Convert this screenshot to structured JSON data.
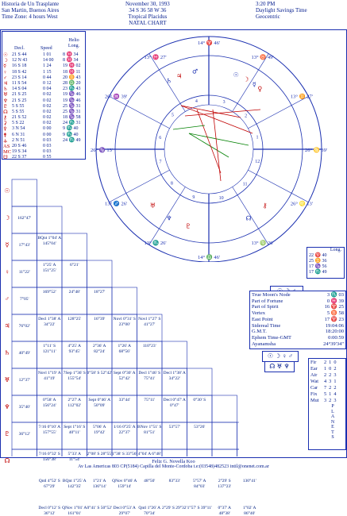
{
  "header": {
    "left": [
      "Historia de Un Trasplante",
      "San Martin, Buenos Aires",
      "Time Zone: 4 hours West"
    ],
    "center": [
      "November 30, 1993",
      "34 S 36    58 W 36",
      "Tropical Placidus",
      "NATAL CHART"
    ],
    "right": [
      "3:20 PM",
      "Daylight Savings Time",
      "Geocentric"
    ]
  },
  "planet_table": {
    "headers": {
      "decl": "Decl.",
      "speed": "Speed",
      "helio": "Helio Long."
    },
    "rows": [
      {
        "decl": "21 S 44",
        "speed": "1 01",
        "helio": "8 ♓ 34"
      },
      {
        "decl": "12 N 43",
        "speed": "14 00",
        "helio": "8 ♓ 34"
      },
      {
        "decl": "16 S 18",
        "speed": "1 24",
        "helio": "19 ♓ 02"
      },
      {
        "decl": "18 S 42",
        "speed": "1 15",
        "helio": "18 ♓ 11"
      },
      {
        "decl": "23 S 14",
        "speed": "0 44",
        "helio": "20 ♊ 43"
      },
      {
        "decl": "11 S 54",
        "speed": "0 12",
        "helio": "28 ♎ 20"
      },
      {
        "decl": "14 S 04",
        "speed": "0 04",
        "helio": "23 ♏ 43"
      },
      {
        "decl": "21 S 25",
        "speed": "0 02",
        "helio": "19 ♑ 46"
      },
      {
        "decl": "21 S 25",
        "speed": "0 02",
        "helio": "19 ♑ 46"
      },
      {
        "decl": "5 S 55",
        "speed": "0 02",
        "helio": "25 ♑ 31"
      },
      {
        "decl": "5 S 55",
        "speed": "0 02",
        "helio": "25 ♑ 31"
      },
      {
        "decl": "21 S 52",
        "speed": "0 02",
        "helio": "18 ♑ 58"
      },
      {
        "decl": "5 S 22",
        "speed": "0 02",
        "helio": "24 ♏ 31"
      },
      {
        "decl": "3 N 54",
        "speed": "0 00",
        "helio": "9 ♏ 40"
      },
      {
        "decl": "6 N 31",
        "speed": "0 00",
        "helio": "9 ♏ 40"
      },
      {
        "decl": "2 N 51",
        "speed": "0 03",
        "helio": "24 ♏ 49"
      },
      {
        "decl": "20 S 46",
        "speed": "0 03",
        "helio": ""
      },
      {
        "decl": "19 S 34",
        "speed": "0 03",
        "helio": ""
      },
      {
        "decl": "22 S 37",
        "speed": "0 55",
        "helio": ""
      }
    ],
    "glyphs": [
      "☉",
      "☽",
      "☿",
      "♀",
      "♂",
      "♃",
      "♄",
      "♅",
      "♆",
      "♇",
      "☊",
      "⚷",
      "⚳",
      "⚴",
      "⚵",
      "⚶",
      "AS",
      "MC",
      "☋"
    ]
  },
  "wheel": {
    "cusps": [
      "14° ♈ 46'",
      "13° ♉ 49'",
      "13° ♊ 27'",
      "26° ♋ 39'",
      "26° ♌ 13'",
      "13° ♍ 26'",
      "14° ♎ 46'",
      "13° ♏ 26'",
      "13° ♐ 26'",
      "26° ♑ 13'",
      "26° ♒ 39'",
      "13° ♓ 27'"
    ],
    "labels": [
      "14°",
      "46'",
      "13°",
      "49'",
      "26°",
      "13°",
      "26°",
      "39'",
      "13°",
      "26°",
      "14°",
      "46'",
      "27'",
      "13°",
      "26°",
      "39'",
      "47'",
      "15°",
      "02°",
      "24°",
      "04°",
      "08°",
      "18°",
      "18°",
      "21°",
      "47°",
      "53°",
      "25°",
      "23°",
      "14°"
    ]
  },
  "aspect_grid": {
    "left_glyphs": [
      "☉",
      "☽",
      "☿",
      "♀",
      "♂",
      "♃",
      "♄",
      "♅",
      "♆",
      "♇",
      "☊",
      "AS",
      "MC"
    ],
    "first_col": [
      "162°47'",
      "17°43'",
      "11°22'",
      "7°05'",
      "76°02'",
      "40°49'",
      "12°37'",
      "35°40'",
      "36°12'"
    ],
    "cells": [
      [
        "BQnt 1°04' A 145°04'"
      ],
      [
        "1°25' A 151°25'",
        "6°21'"
      ],
      [
        "169°52'",
        "24°48'",
        "18°27'"
      ],
      [
        "Decl 1°38' A 34°22'",
        "128°25'",
        "16°39'",
        "Novl 0°31' S 23°00'",
        "Novl 1°27' S 41°27'"
      ],
      [
        "1°11' S 121°11'",
        "4°25' A 93°45'",
        "2°36' A 82°24'",
        "1°26' A 68°56'",
        "110°23'"
      ],
      [
        "Novl 1°19' A 41°19'",
        "7Sep 1°36' S 155°54'",
        "0°58' S 52°42'",
        "Sept 0°30' A 52°42'",
        "Decl 1°46' S 75°41'",
        "Decl 1°38' A 34°22'"
      ],
      [
        "0°58' A 156°24'",
        "2°27' A 112°02'",
        "Sept 0°46' A 50°09'",
        "33°44'",
        "75°11'",
        "Decl 0°47' A 0°47'",
        "0°30' S"
      ],
      [
        "7/16 0°10' A 157°55'",
        "Sept 1°16' S 40°11'",
        "5°06' A 19°42'",
        "1/16 0°25' A 22°37'",
        "BNov 1°51' S 81°51'",
        "53°57'",
        "53°26'"
      ],
      [
        "7/16 0°32' S 156°38'",
        "5°33' A 11°54'",
        "2°08' S 28°55'",
        "1°38' S 33°56'",
        "4°04' A 6°48'"
      ],
      [
        "Qntl 4°52' S 67°29'",
        "BQnt 1°25' A 142°35'",
        "1°21' A 136°14'",
        "QNov 0°46' A 159°14'",
        "48°50'",
        "83°33'",
        "5°57' A 84°03'",
        "2°29' S 137°23'",
        "130°41'"
      ],
      [
        "Decl 0°12' S 36°12'",
        "QNov 1°01' A 161°01'",
        "0°41' S 50°52'",
        "Decl 0°53' A 29°07'",
        "Qntl 1°26' A 70°34'",
        "2°29' S 29°32'",
        "1°57' S 39°11'",
        "0°37' A 48°38'",
        "1°02' A 86°40'"
      ]
    ]
  },
  "house_longs": {
    "title": "Long.",
    "rows": [
      "22 ♈ 40",
      "25 ♊ 36",
      "17 ♑ 56",
      "17 ♏ 49"
    ]
  },
  "points_table": {
    "rows": [
      {
        "label": "True Moon's Node",
        "value": "3 ♏ 03"
      },
      {
        "label": "Part of Fortune",
        "value": "0 ♓ 39"
      },
      {
        "label": "Part of Spirit",
        "value": "16 ♈ 25"
      },
      {
        "label": "Vertex",
        "value": "5 ♉ 58"
      },
      {
        "label": "East Point",
        "value": "17 ♈ 23"
      },
      {
        "label": "Sidereal Time",
        "value": "19:04:06"
      },
      {
        "label": "G.M.T.",
        "value": "18:20:00"
      },
      {
        "label": "Ephem Time-GMT",
        "value": "0:00:59"
      },
      {
        "label": "Ayanamsha",
        "value": "24°39'34\""
      }
    ]
  },
  "elements_table": {
    "rows": [
      [
        "Fir",
        "2",
        "1",
        "0"
      ],
      [
        "Ear",
        "1",
        "0",
        "2"
      ],
      [
        "Air",
        "2",
        "2",
        "3"
      ],
      [
        "Wat",
        "4",
        "3",
        "1"
      ],
      [
        "Car",
        "7",
        "2",
        "2"
      ],
      [
        "Fix",
        "5",
        "1",
        "4"
      ],
      [
        "Mut",
        "3",
        "2",
        "3"
      ]
    ],
    "vertical": "PLANETS"
  },
  "footer": {
    "line1": "Feliz G. Novella Koo",
    "line2": "Av Las Americas 803 CP(5184)   Capilla del Monte-Cordoba   t.e:(03548)482523 intil@onenet.com.ar"
  },
  "colors": {
    "ink": "#001a8c",
    "red": "#c00000",
    "green": "#008000",
    "border": "#1a2fb0"
  }
}
